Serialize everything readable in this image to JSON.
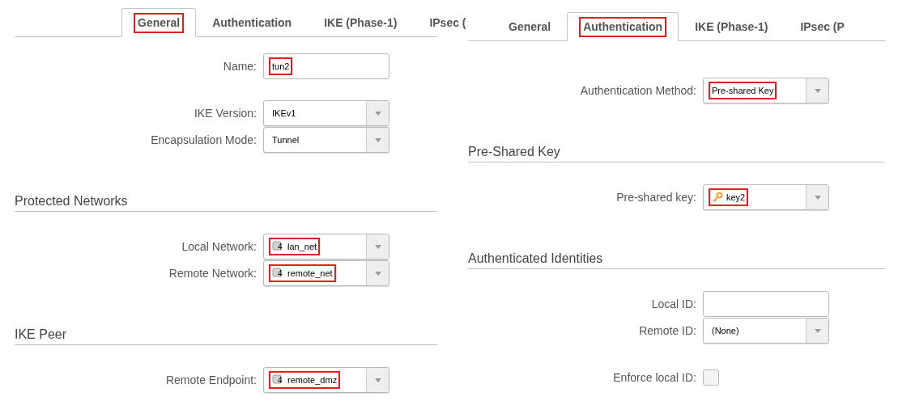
{
  "panels": [
    {
      "tabs": [
        {
          "label": "General",
          "selected": true,
          "highlighted": true
        },
        {
          "label": "Authentication",
          "selected": false,
          "highlighted": false
        },
        {
          "label": "IKE (Phase-1)",
          "selected": false,
          "highlighted": false
        },
        {
          "label": "IPsec (",
          "selected": false,
          "highlighted": false
        }
      ],
      "sections": [
        {
          "groups": [
            [
              {
                "kind": "text",
                "label": "Name:",
                "value": "tun2",
                "highlighted": true
              }
            ],
            [
              {
                "kind": "select",
                "label": "IKE Version:",
                "value": "IKEv1",
                "highlighted": false
              },
              {
                "kind": "select",
                "label": "Encapsulation Mode:",
                "value": "Tunnel",
                "highlighted": false
              }
            ]
          ]
        },
        {
          "heading": "Protected Networks",
          "groups": [
            [
              {
                "kind": "network_select",
                "label": "Local Network:",
                "value": "lan_net",
                "icon_text": "4",
                "highlighted": true
              },
              {
                "kind": "network_select",
                "label": "Remote Network:",
                "value": "remote_net",
                "icon_text": "4",
                "highlighted": true
              }
            ]
          ]
        },
        {
          "heading": "IKE Peer",
          "groups": [
            [
              {
                "kind": "network_select",
                "label": "Remote Endpoint:",
                "value": "remote_dmz",
                "icon_text": "4",
                "highlighted": true
              }
            ]
          ]
        }
      ]
    },
    {
      "tabs": [
        {
          "label": "General",
          "selected": false,
          "highlighted": false
        },
        {
          "label": "Authentication",
          "selected": true,
          "highlighted": true
        },
        {
          "label": "IKE (Phase-1)",
          "selected": false,
          "highlighted": false
        },
        {
          "label": "IPsec (P",
          "selected": false,
          "highlighted": false
        }
      ],
      "sections": [
        {
          "groups": [
            [
              {
                "kind": "select",
                "label": "Authentication Method:",
                "value": "Pre-shared Key",
                "highlighted": true
              }
            ]
          ]
        },
        {
          "heading": "Pre-Shared Key",
          "groups": [
            [
              {
                "kind": "key_select",
                "label": "Pre-shared key:",
                "value": "key2",
                "highlighted": true
              }
            ]
          ]
        },
        {
          "heading": "Authenticated Identities",
          "groups": [
            [
              {
                "kind": "text",
                "label": "Local ID:"
              },
              {
                "kind": "select",
                "label": "Remote ID:",
                "value": "(None)",
                "highlighted": false
              }
            ],
            [
              {
                "kind": "checkbox",
                "label": "Enforce local ID:",
                "checked": false
              }
            ]
          ]
        }
      ]
    }
  ]
}
